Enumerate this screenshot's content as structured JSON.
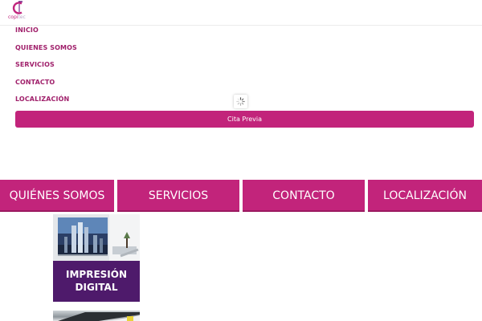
{
  "header": {
    "logo_text": "copi",
    "logo_text_sub": "tec"
  },
  "menu": {
    "items": [
      {
        "label": "INICIO"
      },
      {
        "label": "QUIENES SOMOS"
      },
      {
        "label": "SERVICIOS"
      },
      {
        "label": "CONTACTO"
      },
      {
        "label": "LOCALIZACIÓN"
      }
    ]
  },
  "cta": {
    "label": "Cita Previa"
  },
  "tiles": [
    {
      "label": "QUIÉNES SOMOS"
    },
    {
      "label": "SERVICIOS"
    },
    {
      "label": "CONTACTO"
    },
    {
      "label": "LOCALIZACIÓN"
    }
  ],
  "cards": [
    {
      "line1": "IMPRESIÓN",
      "line2": "DIGITAL"
    }
  ],
  "colors": {
    "brand": "#c2247b",
    "menu_text": "#a0206b",
    "card_caption": "#4e1a6b"
  },
  "icons": {
    "loader": "spinner-icon",
    "logo": "copitec-logo-icon"
  }
}
